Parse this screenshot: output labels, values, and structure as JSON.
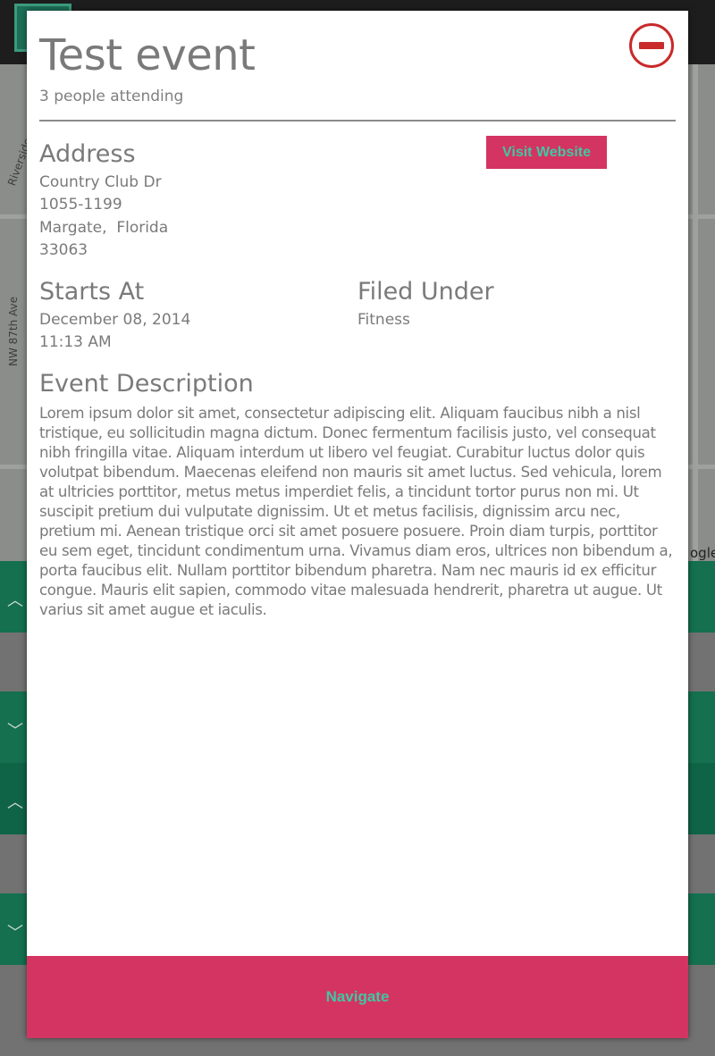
{
  "background": {
    "map_labels": [
      "Riverside",
      "NW 87th Ave",
      "ogle"
    ]
  },
  "event": {
    "title": "Test event",
    "attending": "3 people attending",
    "close_icon": "minus-circle-icon"
  },
  "address": {
    "heading": "Address",
    "line1": "Country Club Dr",
    "line2": "1055-1199",
    "line3": "Margate,  Florida",
    "line4": "33063"
  },
  "visit_website_label": "Visit Website",
  "starts": {
    "heading": "Starts At",
    "date": "December 08, 2014",
    "time": "11:13 AM"
  },
  "filed": {
    "heading": "Filed Under",
    "category": "Fitness"
  },
  "description": {
    "heading": "Event Description",
    "body": "Lorem ipsum dolor sit amet, consectetur adipiscing elit. Aliquam faucibus nibh a nisl tristique, eu sollicitudin magna dictum. Donec fermentum facilisis justo, vel consequat nibh fringilla vitae. Aliquam interdum ut libero vel feugiat. Curabitur luctus dolor quis volutpat bibendum. Maecenas eleifend non mauris sit amet luctus. Sed vehicula, lorem at ultricies porttitor, metus metus imperdiet felis, a tincidunt tortor purus non mi. Ut suscipit pretium dui vulputate dignissim. Ut et metus facilisis, dignissim arcu nec, pretium mi. Aenean tristique orci sit amet posuere posuere. Proin diam turpis, porttitor eu sem eget, tincidunt condimentum urna. Vivamus diam eros, ultrices non bibendum a, porta faucibus elit. Nullam porttitor bibendum pharetra. Nam nec mauris id ex efficitur congue. Mauris elit sapien, commodo vitae malesuada hendrerit, pharetra ut augue. Ut varius sit amet augue et iaculis."
  },
  "navigate_label": "Navigate",
  "colors": {
    "accent_pink": "#d43461",
    "accent_green_text": "#3fc8a4",
    "close_red": "#c92a2a",
    "text_gray": "#7a7a7a"
  }
}
